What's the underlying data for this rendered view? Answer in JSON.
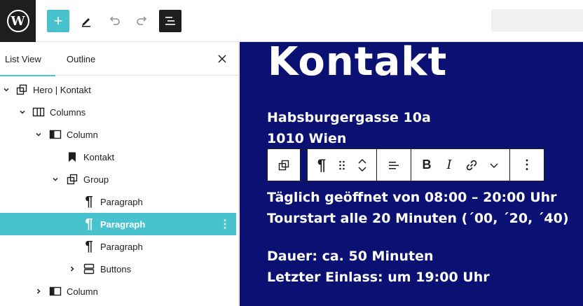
{
  "sidebar": {
    "tabs": [
      {
        "label": "List View",
        "active": true
      },
      {
        "label": "Outline",
        "active": false
      }
    ],
    "close_icon": "close-icon",
    "tree": [
      {
        "label": "Hero | Kontakt",
        "icon": "group-icon",
        "expanded": true,
        "level": 1
      },
      {
        "label": "Columns",
        "icon": "columns-icon",
        "expanded": true,
        "level": 2
      },
      {
        "label": "Column",
        "icon": "column-icon",
        "expanded": true,
        "level": 3
      },
      {
        "label": "Kontakt",
        "icon": "bookmark-icon",
        "expanded": null,
        "level": 4
      },
      {
        "label": "Group",
        "icon": "group-icon",
        "expanded": true,
        "level": 4
      },
      {
        "label": "Paragraph",
        "icon": "paragraph-icon",
        "expanded": null,
        "level": 5
      },
      {
        "label": "Paragraph",
        "icon": "paragraph-icon",
        "expanded": null,
        "level": 5,
        "selected": true
      },
      {
        "label": "Paragraph",
        "icon": "paragraph-icon",
        "expanded": null,
        "level": 5
      },
      {
        "label": "Buttons",
        "icon": "buttons-icon",
        "expanded": false,
        "level": 5
      },
      {
        "label": "Column",
        "icon": "column-icon",
        "expanded": false,
        "level": 3
      }
    ]
  },
  "toolbar": {
    "add_icon": "plus-icon",
    "edit_icon": "pencil-icon",
    "undo_icon": "undo-icon",
    "redo_icon": "redo-icon",
    "list_view_icon": "list-view-icon"
  },
  "canvas": {
    "heading": "Kontakt",
    "address_line1": "Habsburgergasse 10a",
    "address_line2": "1010 Wien",
    "hours_line1": "Täglich geöffnet von 08:00 – 20:00 Uhr",
    "hours_line2": "Tourstart alle 20 Minuten (´00, ´20, ´40)",
    "duration_line1": "Dauer: ca. 50 Minuten",
    "duration_line2": "Letzter Einlass: um 19:00 Uhr",
    "background_color": "#0a1172"
  },
  "block_toolbar": {
    "paragraph_symbol": "¶",
    "bold_label": "B",
    "italic_label": "I",
    "more_label": "⋮"
  },
  "colors": {
    "accent": "#48c2cd",
    "dark": "#1e1e1e"
  }
}
